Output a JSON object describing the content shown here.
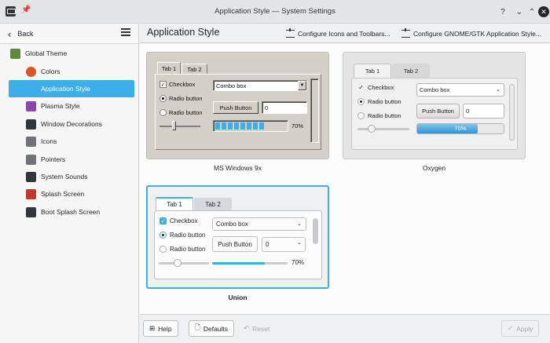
{
  "window": {
    "title": "Application Style — System Settings"
  },
  "sidebar": {
    "back_label": "Back",
    "items": [
      {
        "label": "Global Theme",
        "icon": "global-theme-icon",
        "color": "#5a8a3a"
      },
      {
        "label": "Colors",
        "icon": "colors-icon",
        "color": "#d9542b"
      },
      {
        "label": "Application Style",
        "icon": "application-style-icon",
        "color": "#3daee9"
      },
      {
        "label": "Plasma Style",
        "icon": "plasma-style-icon",
        "color": "#8e44ad"
      },
      {
        "label": "Window Decorations",
        "icon": "window-decorations-icon",
        "color": "#31363b"
      },
      {
        "label": "Icons",
        "icon": "icons-icon",
        "color": "#6f7377"
      },
      {
        "label": "Pointers",
        "icon": "pointers-icon",
        "color": "#6f7377"
      },
      {
        "label": "System Sounds",
        "icon": "system-sounds-icon",
        "color": "#31363b"
      },
      {
        "label": "Splash Screen",
        "icon": "splash-screen-icon",
        "color": "#c0392b"
      },
      {
        "label": "Boot Splash Screen",
        "icon": "boot-splash-screen-icon",
        "color": "#31363b"
      }
    ],
    "active_index": 2
  },
  "header": {
    "page_title": "Application Style",
    "configure_toolbars_label": "Configure Icons and Toolbars...",
    "configure_gtk_label": "Configure GNOME/GTK Application Style..."
  },
  "styles": [
    {
      "name": "MS Windows 9x",
      "tab1": "Tab 1",
      "tab2": "Tab 2",
      "checkbox": "Checkbox",
      "radio1": "Radio button",
      "radio2": "Radio button",
      "combo": "Combo box",
      "push": "Push Button",
      "spin": "0",
      "progress": "70%",
      "progress_value": 0.7,
      "slider_value": 0.3
    },
    {
      "name": "Oxygen",
      "tab1": "Tab 1",
      "tab2": "Tab 2",
      "checkbox": "Checkbox",
      "radio1": "Radio button",
      "radio2": "Radio button",
      "combo": "Combo box",
      "push": "Push Button",
      "spin": "0",
      "progress": "70%",
      "progress_value": 0.7,
      "slider_value": 0.2
    },
    {
      "name": "Union",
      "tab1": "Tab 1",
      "tab2": "Tab 2",
      "checkbox": "Checkbox",
      "radio1": "Radio button",
      "radio2": "Radio button",
      "combo": "Combo box",
      "push": "Push Button",
      "spin": "0",
      "progress": "70%",
      "progress_value": 0.7,
      "slider_value": 0.3
    }
  ],
  "footer": {
    "help": "Help",
    "defaults": "Defaults",
    "reset": "Reset",
    "apply": "Apply"
  },
  "colors": {
    "accent": "#3daee9",
    "selected_border": "#3daee9"
  }
}
